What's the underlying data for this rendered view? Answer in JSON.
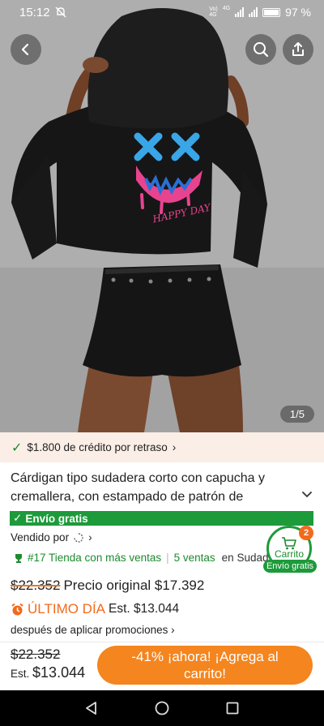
{
  "status_bar": {
    "time": "15:12",
    "network_top": "Vo)",
    "network_bottom": "4G",
    "network2": "4G",
    "battery": "97 %"
  },
  "header": {
    "back_icon": "chevron-left-icon",
    "search_icon": "search-icon",
    "share_icon": "share-icon"
  },
  "gallery": {
    "counter": "1/5",
    "print_text": "HAPPY DAY"
  },
  "credit": {
    "text": "$1.800 de crédito por retraso",
    "chevron": "›"
  },
  "product": {
    "title": "Cárdigan tipo sudadera corto con capucha y cremallera, con estampado de patrón de",
    "free_shipping": "Envío gratis",
    "sold_by": "Vendido por",
    "rank_text": "#17 Tienda con más ventas",
    "sales_text": "5 ventas",
    "region_text": "en Sudad"
  },
  "cart_widget": {
    "label": "Carrito",
    "badge": "2",
    "free_label": "Envío gratis"
  },
  "pricing": {
    "old_price": "$22.352",
    "original_label": "Precio original $17.392",
    "last_day": "ÚLTIMO DÍA",
    "est_price": "Est. $13.044",
    "promo_note": "después de aplicar promociones"
  },
  "bottom_bar": {
    "old_price": "$22.352",
    "est_label": "Est.",
    "est_value": "$13.044",
    "cta": "-41% ¡ahora! ¡Agrega al carrito!"
  },
  "colors": {
    "accent_orange": "#f4851f",
    "green": "#1d9a3a",
    "credit_bg": "#fbeee7"
  }
}
